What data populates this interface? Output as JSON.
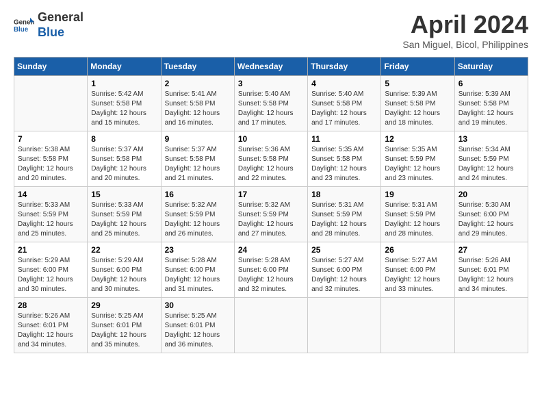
{
  "app": {
    "logo_line1": "General",
    "logo_line2": "Blue"
  },
  "header": {
    "title": "April 2024",
    "location": "San Miguel, Bicol, Philippines"
  },
  "calendar": {
    "days_of_week": [
      "Sunday",
      "Monday",
      "Tuesday",
      "Wednesday",
      "Thursday",
      "Friday",
      "Saturday"
    ],
    "weeks": [
      [
        {
          "day": "",
          "info": ""
        },
        {
          "day": "1",
          "info": "Sunrise: 5:42 AM\nSunset: 5:58 PM\nDaylight: 12 hours\nand 15 minutes."
        },
        {
          "day": "2",
          "info": "Sunrise: 5:41 AM\nSunset: 5:58 PM\nDaylight: 12 hours\nand 16 minutes."
        },
        {
          "day": "3",
          "info": "Sunrise: 5:40 AM\nSunset: 5:58 PM\nDaylight: 12 hours\nand 17 minutes."
        },
        {
          "day": "4",
          "info": "Sunrise: 5:40 AM\nSunset: 5:58 PM\nDaylight: 12 hours\nand 17 minutes."
        },
        {
          "day": "5",
          "info": "Sunrise: 5:39 AM\nSunset: 5:58 PM\nDaylight: 12 hours\nand 18 minutes."
        },
        {
          "day": "6",
          "info": "Sunrise: 5:39 AM\nSunset: 5:58 PM\nDaylight: 12 hours\nand 19 minutes."
        }
      ],
      [
        {
          "day": "7",
          "info": "Sunrise: 5:38 AM\nSunset: 5:58 PM\nDaylight: 12 hours\nand 20 minutes."
        },
        {
          "day": "8",
          "info": "Sunrise: 5:37 AM\nSunset: 5:58 PM\nDaylight: 12 hours\nand 20 minutes."
        },
        {
          "day": "9",
          "info": "Sunrise: 5:37 AM\nSunset: 5:58 PM\nDaylight: 12 hours\nand 21 minutes."
        },
        {
          "day": "10",
          "info": "Sunrise: 5:36 AM\nSunset: 5:58 PM\nDaylight: 12 hours\nand 22 minutes."
        },
        {
          "day": "11",
          "info": "Sunrise: 5:35 AM\nSunset: 5:58 PM\nDaylight: 12 hours\nand 23 minutes."
        },
        {
          "day": "12",
          "info": "Sunrise: 5:35 AM\nSunset: 5:59 PM\nDaylight: 12 hours\nand 23 minutes."
        },
        {
          "day": "13",
          "info": "Sunrise: 5:34 AM\nSunset: 5:59 PM\nDaylight: 12 hours\nand 24 minutes."
        }
      ],
      [
        {
          "day": "14",
          "info": "Sunrise: 5:33 AM\nSunset: 5:59 PM\nDaylight: 12 hours\nand 25 minutes."
        },
        {
          "day": "15",
          "info": "Sunrise: 5:33 AM\nSunset: 5:59 PM\nDaylight: 12 hours\nand 25 minutes."
        },
        {
          "day": "16",
          "info": "Sunrise: 5:32 AM\nSunset: 5:59 PM\nDaylight: 12 hours\nand 26 minutes."
        },
        {
          "day": "17",
          "info": "Sunrise: 5:32 AM\nSunset: 5:59 PM\nDaylight: 12 hours\nand 27 minutes."
        },
        {
          "day": "18",
          "info": "Sunrise: 5:31 AM\nSunset: 5:59 PM\nDaylight: 12 hours\nand 28 minutes."
        },
        {
          "day": "19",
          "info": "Sunrise: 5:31 AM\nSunset: 5:59 PM\nDaylight: 12 hours\nand 28 minutes."
        },
        {
          "day": "20",
          "info": "Sunrise: 5:30 AM\nSunset: 6:00 PM\nDaylight: 12 hours\nand 29 minutes."
        }
      ],
      [
        {
          "day": "21",
          "info": "Sunrise: 5:29 AM\nSunset: 6:00 PM\nDaylight: 12 hours\nand 30 minutes."
        },
        {
          "day": "22",
          "info": "Sunrise: 5:29 AM\nSunset: 6:00 PM\nDaylight: 12 hours\nand 30 minutes."
        },
        {
          "day": "23",
          "info": "Sunrise: 5:28 AM\nSunset: 6:00 PM\nDaylight: 12 hours\nand 31 minutes."
        },
        {
          "day": "24",
          "info": "Sunrise: 5:28 AM\nSunset: 6:00 PM\nDaylight: 12 hours\nand 32 minutes."
        },
        {
          "day": "25",
          "info": "Sunrise: 5:27 AM\nSunset: 6:00 PM\nDaylight: 12 hours\nand 32 minutes."
        },
        {
          "day": "26",
          "info": "Sunrise: 5:27 AM\nSunset: 6:00 PM\nDaylight: 12 hours\nand 33 minutes."
        },
        {
          "day": "27",
          "info": "Sunrise: 5:26 AM\nSunset: 6:01 PM\nDaylight: 12 hours\nand 34 minutes."
        }
      ],
      [
        {
          "day": "28",
          "info": "Sunrise: 5:26 AM\nSunset: 6:01 PM\nDaylight: 12 hours\nand 34 minutes."
        },
        {
          "day": "29",
          "info": "Sunrise: 5:25 AM\nSunset: 6:01 PM\nDaylight: 12 hours\nand 35 minutes."
        },
        {
          "day": "30",
          "info": "Sunrise: 5:25 AM\nSunset: 6:01 PM\nDaylight: 12 hours\nand 36 minutes."
        },
        {
          "day": "",
          "info": ""
        },
        {
          "day": "",
          "info": ""
        },
        {
          "day": "",
          "info": ""
        },
        {
          "day": "",
          "info": ""
        }
      ]
    ]
  }
}
